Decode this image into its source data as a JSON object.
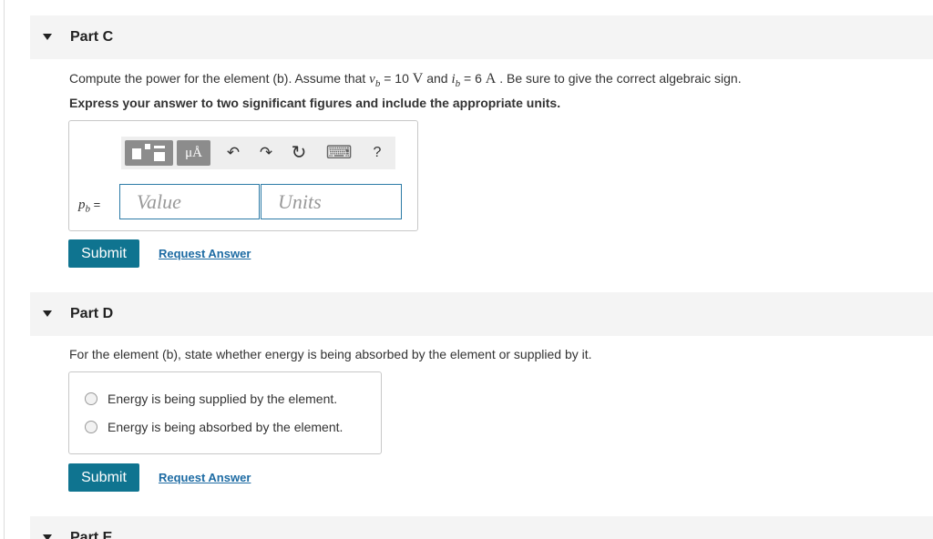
{
  "part_c": {
    "title": "Part C",
    "prompt_prefix": "Compute the power for the element (b). Assume that ",
    "var_v": "v",
    "sub_v": "b",
    "eq1": " = 10 ",
    "unit_v": "V",
    "and": " and ",
    "var_i": "i",
    "sub_i": "b",
    "eq2": " = 6 ",
    "unit_a": "A",
    "prompt_suffix": " . Be sure to give the correct algebraic sign.",
    "instructions": "Express your answer to two significant figures and include the appropriate units.",
    "answer_var": "p",
    "answer_sub": "b",
    "answer_eq": " =",
    "value_placeholder": "Value",
    "units_placeholder": "Units",
    "toolbar": {
      "unit_button": "μÅ",
      "undo_icon": "↶",
      "redo_icon": "↷",
      "reset_icon": "↻",
      "keyboard_icon": "⌨",
      "help_label": "?"
    },
    "submit_label": "Submit",
    "request_label": "Request Answer"
  },
  "part_d": {
    "title": "Part D",
    "prompt": "For the element (b), state whether energy is being absorbed by the element or supplied by it.",
    "options": [
      "Energy is being supplied by the element.",
      "Energy is being absorbed by the element."
    ],
    "submit_label": "Submit",
    "request_label": "Request Answer"
  },
  "part_e": {
    "title": "Part E"
  },
  "colors": {
    "accent": "#0f7490",
    "link": "#1d6ba3",
    "header_bg": "#f4f4f4",
    "field_border": "#2b7aa6"
  }
}
